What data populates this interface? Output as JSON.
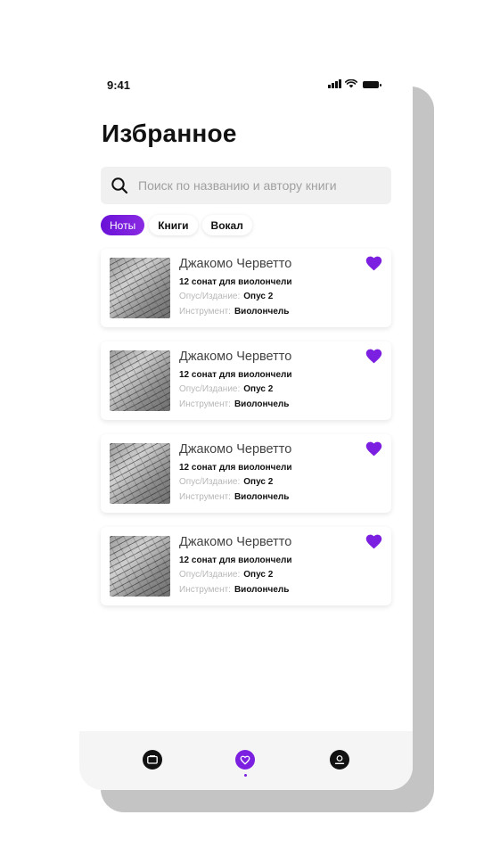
{
  "status_bar": {
    "time": "9:41"
  },
  "page": {
    "title": "Избранное"
  },
  "search": {
    "placeholder": "Поиск по названию и автору книги"
  },
  "filters": [
    {
      "label": "Ноты",
      "active": true
    },
    {
      "label": "Книги",
      "active": false
    },
    {
      "label": "Вокал",
      "active": false
    }
  ],
  "items": [
    {
      "composer": "Джакомо Черветто",
      "work": "12 сонат для виолончели",
      "opus_label": "Опус/Издание:",
      "opus_value": "Опус 2",
      "instrument_label": "Инструмент:",
      "instrument_value": "Виолончель",
      "favorite": true
    },
    {
      "composer": "Джакомо Черветто",
      "work": "12 сонат для виолончели",
      "opus_label": "Опус/Издание:",
      "opus_value": "Опус 2",
      "instrument_label": "Инструмент:",
      "instrument_value": "Виолончель",
      "favorite": true
    },
    {
      "composer": "Джакомо Черветто",
      "work": "12 сонат для виолончели",
      "opus_label": "Опус/Издание:",
      "opus_value": "Опус 2",
      "instrument_label": "Инструмент:",
      "instrument_value": "Виолончель",
      "favorite": true
    },
    {
      "composer": "Джакомо Черветто",
      "work": "12 сонат для виолончели",
      "opus_label": "Опус/Издание:",
      "opus_value": "Опус 2",
      "instrument_label": "Инструмент:",
      "instrument_value": "Виолончель",
      "favorite": true
    }
  ],
  "tab_bar": {
    "tabs": [
      {
        "icon": "catalog-icon",
        "active": false
      },
      {
        "icon": "heart-icon",
        "active": true
      },
      {
        "icon": "profile-icon",
        "active": false
      }
    ]
  },
  "colors": {
    "accent": "#7b1fe0",
    "heart": "#7b1fe0",
    "background": "#ffffff",
    "shadow_card": "#c4c4c4"
  }
}
